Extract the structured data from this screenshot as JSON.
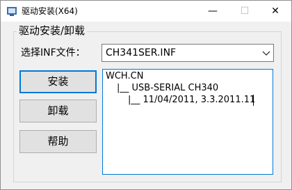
{
  "window": {
    "title": "驱动安装(X64)",
    "minimize_glyph": "—",
    "maximize_glyph": "☐",
    "close_glyph": "✕"
  },
  "group": {
    "legend": "驱动安装/卸载"
  },
  "inf": {
    "label": "选择INF文件：",
    "selected": "CH341SER.INF"
  },
  "buttons": {
    "install": "安装",
    "uninstall": "卸载",
    "help": "帮助"
  },
  "info": {
    "line1": "WCH.CN",
    "line2": "|__ USB-SERIAL CH340",
    "line3": "|__ 11/04/2011, 3.3.2011.11"
  },
  "colors": {
    "focus_border": "#0078d7",
    "button_face": "#e1e1e1",
    "window_bg": "#f0f0f0"
  },
  "icons": {
    "app": "usb-driver-icon",
    "dropdown": "chevron-down-icon"
  }
}
